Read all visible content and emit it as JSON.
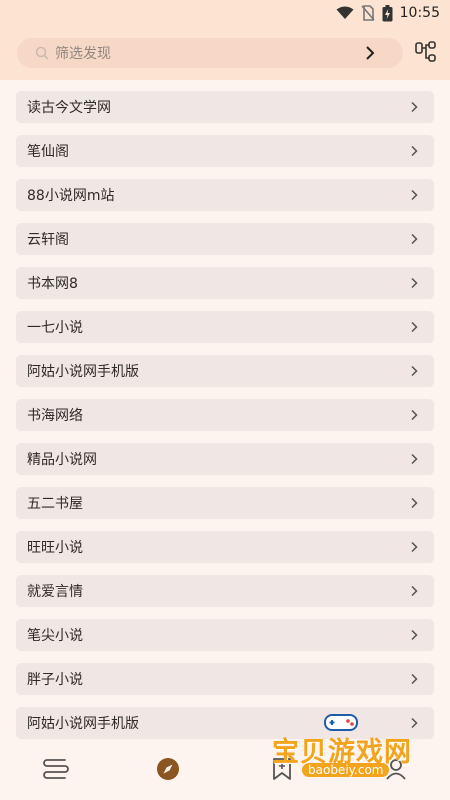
{
  "status_bar": {
    "time": "10:55"
  },
  "search": {
    "placeholder": "筛选发现"
  },
  "sources": [
    "读古今文学网",
    "笔仙阁",
    "88小说网m站",
    "云轩阁",
    "书本网8",
    "一七小说",
    "阿姑小说网手机版",
    "书海网络",
    " 精品小说网",
    " 五二书屋",
    "旺旺小说",
    "就爱言情",
    "笔尖小说",
    "胖子小说",
    "阿姑小说网手机版"
  ],
  "watermark": {
    "title": "宝贝游戏网",
    "url": "baobeiy.com"
  },
  "colors": {
    "header_bg": "#fde4d2",
    "page_bg": "#fdf3ef",
    "row_bg": "#f0e6e3",
    "active_tab": "#8a5520",
    "watermark": "#f3a31c"
  },
  "icons": {
    "wifi": "wifi-icon",
    "sim": "no-sim-icon",
    "battery": "battery-charging-icon",
    "search": "search-icon",
    "go": "chevron-right-icon",
    "filter": "group-filter-icon",
    "row_arrow": "chevron-right-icon",
    "tab_bookshelf": "bookshelf-icon",
    "tab_explore": "compass-icon",
    "tab_bookmark": "bookmark-icon",
    "tab_profile": "person-icon"
  }
}
